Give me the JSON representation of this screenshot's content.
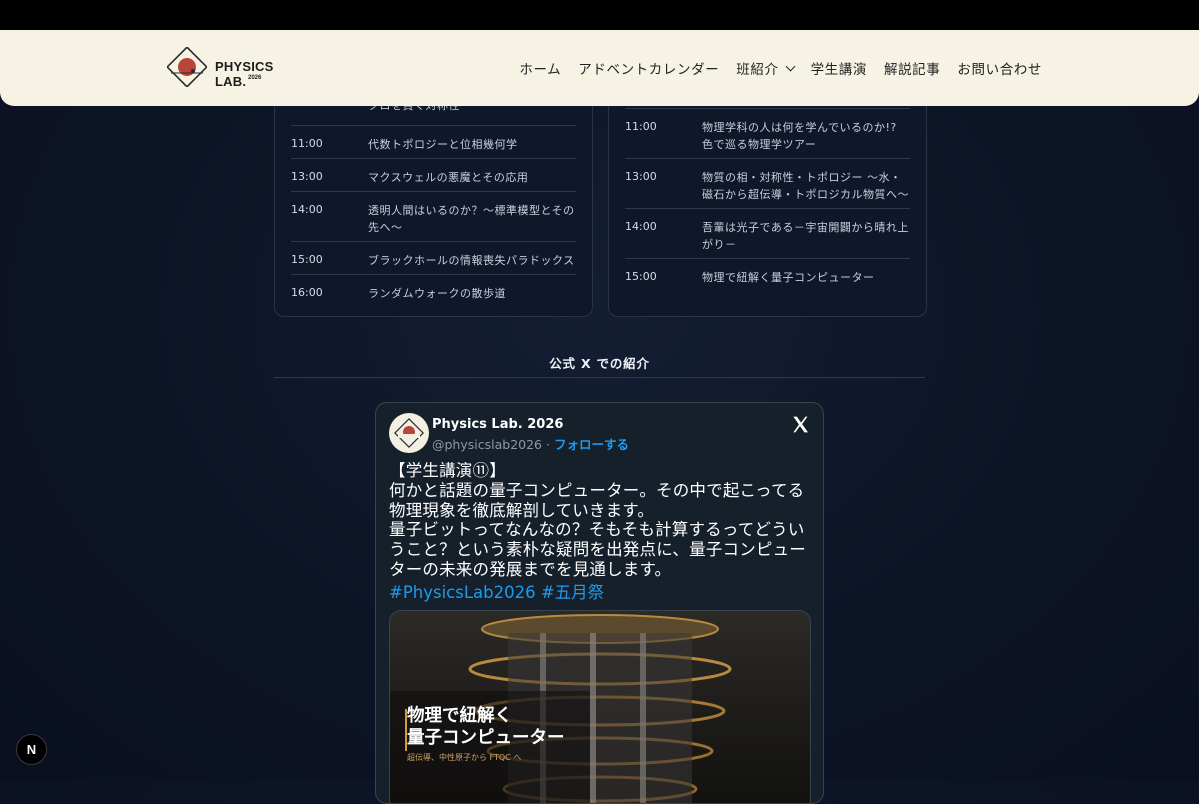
{
  "header": {
    "logo_text": "PHYSICS LAB.",
    "logo_year": "2026",
    "nav": [
      "ホーム",
      "アドベントカレンダー",
      "班紹介",
      "学生講演",
      "解説記事",
      "お問い合わせ"
    ]
  },
  "schedule_left": [
    {
      "time": "",
      "title": "クロを貫く対称性"
    },
    {
      "time": "11:00",
      "title": "代数トポロジーと位相幾何学"
    },
    {
      "time": "13:00",
      "title": "マクスウェルの悪魔とその応用"
    },
    {
      "time": "14:00",
      "title": "透明人間はいるのか？〜標準模型とその先へ〜"
    },
    {
      "time": "15:00",
      "title": "ブラックホールの情報喪失パラドックス"
    },
    {
      "time": "16:00",
      "title": "ランダムウォークの散歩道"
    }
  ],
  "schedule_right": [
    {
      "time": "11:00",
      "title": "物理学科の人は何を学んでいるのか!? 色で巡る物理学ツアー"
    },
    {
      "time": "13:00",
      "title": "物質の相・対称性・トポロジー 〜水・磁石から超伝導・トポロジカル物質へ〜"
    },
    {
      "time": "14:00",
      "title": "吾輩は光子である－宇宙開闢から晴れ上がり－"
    },
    {
      "time": "15:00",
      "title": "物理で紐解く量子コンピューター"
    }
  ],
  "section": {
    "title": "公式 X での紹介"
  },
  "tweet": {
    "name": "Physics Lab. 2026",
    "handle": "@physicslab2026",
    "separator": " · ",
    "follow": "フォローする",
    "body": "【学生講演⑪】\n何かと話題の量子コンピューター。その中で起こってる\n物理現象を徹底解剖していきます。\n量子ビットってなんなの？そもそも計算するってどうい\nうこと？という素朴な疑問を出発点に、量子コンピュー\nターの未来の発展までを見通します。",
    "hashtags": "#PhysicsLab2026 #五月祭",
    "media_title": "物理で紐解く\n量子コンピューター",
    "media_subtitle": "超伝導、中性原子から FTQC へ"
  },
  "next_badge": "N",
  "colors": {
    "header_bg": "#f6f3e4",
    "page_bg": "#0d1426",
    "link": "#1d9bf0",
    "logo_red": "#b8443a"
  }
}
